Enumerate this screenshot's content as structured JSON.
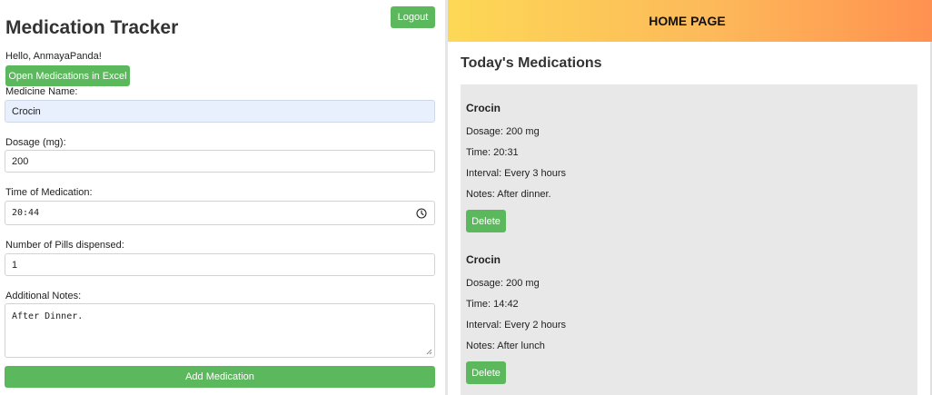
{
  "app": {
    "title": "Medication Tracker",
    "logout_label": "Logout",
    "greeting": "Hello, AnmayaPanda!",
    "excel_label": "Open Medications in Excel"
  },
  "form": {
    "medicine_name": {
      "label": "Medicine Name:",
      "value": "Crocin"
    },
    "dosage": {
      "label": "Dosage (mg):",
      "value": "200"
    },
    "time": {
      "label": "Time of Medication:",
      "value": "20:44"
    },
    "pills": {
      "label": "Number of Pills dispensed:",
      "value": "1"
    },
    "notes": {
      "label": "Additional Notes:",
      "value": "After Dinner."
    },
    "submit_label": "Add Medication"
  },
  "home": {
    "banner_title": "HOME PAGE",
    "section_title": "Today's Medications",
    "delete_label": "Delete",
    "medications": [
      {
        "name": "Crocin",
        "dosage": "Dosage: 200 mg",
        "time": "Time: 20:31",
        "interval": "Interval: Every 3 hours",
        "notes": "Notes: After dinner."
      },
      {
        "name": "Crocin",
        "dosage": "Dosage: 200 mg",
        "time": "Time: 14:42",
        "interval": "Interval: Every 2 hours",
        "notes": "Notes: After lunch"
      }
    ]
  },
  "colors": {
    "primary_green": "#5cb85c",
    "autofill_bg": "#e8f0fe",
    "banner_start": "#fdd856",
    "banner_end": "#ff9150",
    "card_bg": "#e8e8e8"
  },
  "icons": {
    "time_field": "clock-icon",
    "notes_field": "resize-handle-icon"
  }
}
